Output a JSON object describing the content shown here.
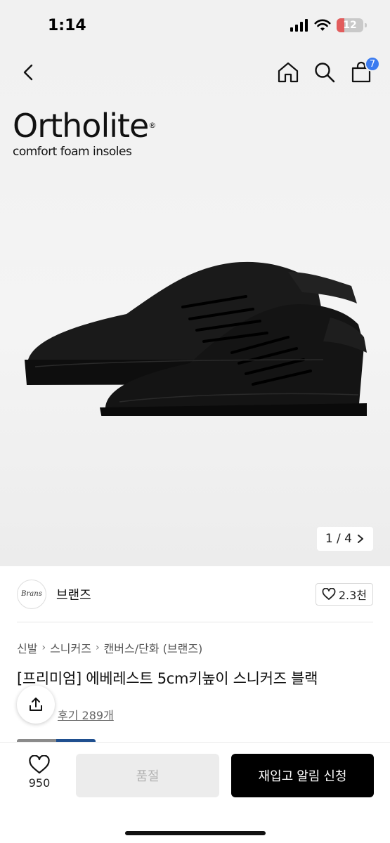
{
  "status": {
    "time": "1:14",
    "battery": "12"
  },
  "header": {
    "cart_count": "7"
  },
  "hero": {
    "brand_logo": {
      "name": "Ortholite",
      "reg": "®",
      "tagline": "comfort foam insoles"
    },
    "image_counter": {
      "current_of_total": "1 / 4"
    }
  },
  "store": {
    "avatar_text": "Brans",
    "name": "브랜즈",
    "likes": "2.3천"
  },
  "breadcrumb": [
    "신발",
    "스니커즈",
    "캔버스/단화 (브랜즈)"
  ],
  "product": {
    "title": "[프리미엄] 에베레스트 5cm키높이 스니커즈 블랙",
    "review_link": "후기 289개"
  },
  "bottom_bar": {
    "wish_count": "950",
    "soldout_label": "품절",
    "restock_label": "재입고 알림 신청"
  },
  "colors": {
    "accent_badge": "#3b7bf0",
    "primary_button": "#000000",
    "disabled_button": "#ececec"
  },
  "icons": [
    "back-icon",
    "home-icon",
    "search-icon",
    "cart-icon",
    "chevron-right-icon",
    "heart-icon",
    "share-icon"
  ]
}
